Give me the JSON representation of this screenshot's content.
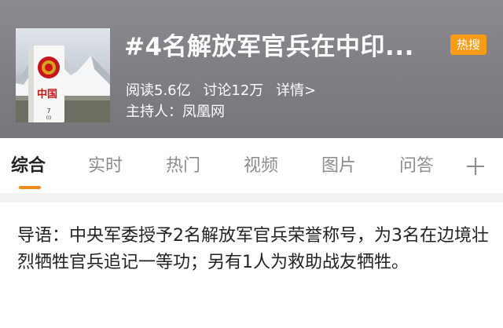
{
  "topic": {
    "title": "#4名解放军官兵在中印...",
    "badge": "热搜",
    "reads": "阅读5.6亿",
    "discussions": "讨论12万",
    "details_link": "详情>",
    "host_label": "主持人：",
    "host_name": "凤凰网"
  },
  "cover_image": {
    "marker_text": "中国",
    "marker_number": "7",
    "marker_sub": "(I)"
  },
  "tabs": [
    {
      "label": "综合",
      "active": true
    },
    {
      "label": "实时",
      "active": false
    },
    {
      "label": "热门",
      "active": false
    },
    {
      "label": "视频",
      "active": false
    },
    {
      "label": "图片",
      "active": false
    },
    {
      "label": "问答",
      "active": false
    }
  ],
  "tab_plus_icon": "plus-icon",
  "intro": {
    "text": "导语：中央军委授予2名解放军官兵荣誉称号，为3名在边境壮烈牺牲官兵追记一等功；另有1人为救助战友牺牲。"
  },
  "colors": {
    "accent": "#f18a1a",
    "badge": "#f59b16",
    "header_bg": "#838287"
  }
}
